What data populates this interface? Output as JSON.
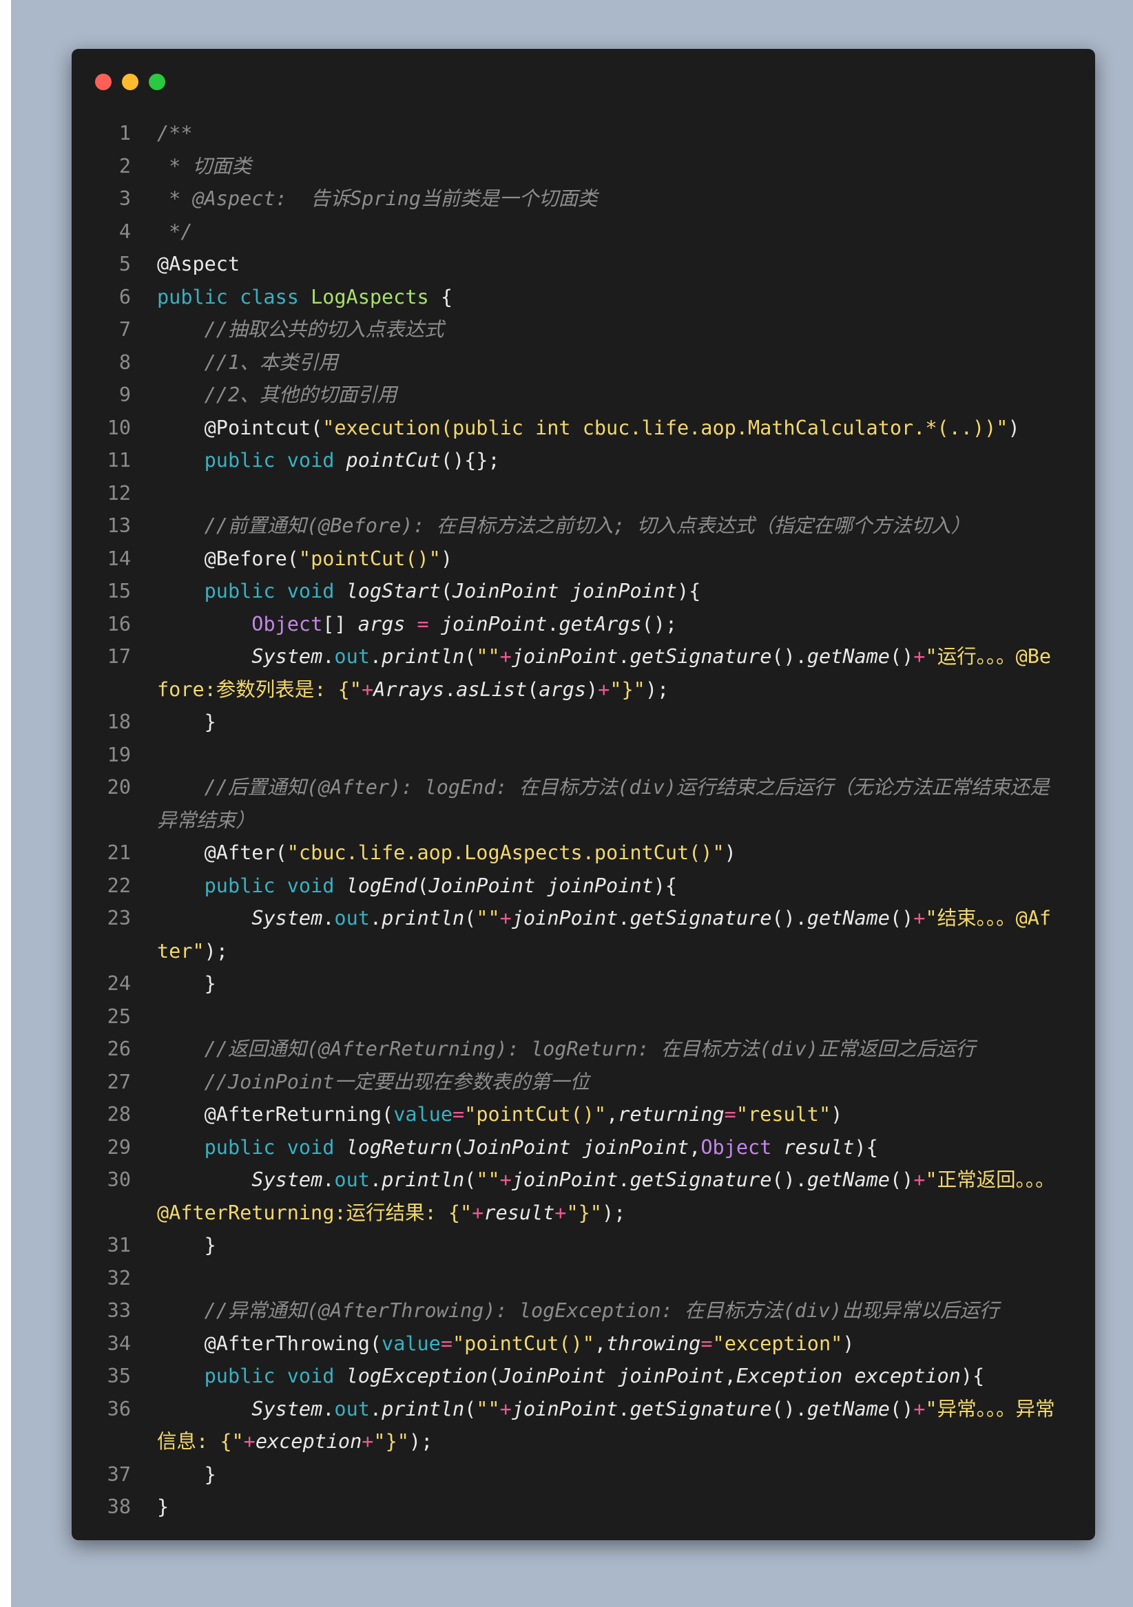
{
  "window": {
    "buttons": [
      {
        "name": "close",
        "color": "#fe5f57"
      },
      {
        "name": "minimize",
        "color": "#febb2e"
      },
      {
        "name": "zoom",
        "color": "#2bc840"
      }
    ]
  },
  "colors": {
    "d": "#e8e8e8",
    "c": "#8c8c8c",
    "k": "#36b2c4",
    "s": "#f3d86b",
    "t": "#a7e265",
    "p": "#c487e6",
    "o": "#f0578f",
    "f": "#e8e8e8",
    "n": "#8b8b8b"
  },
  "code": {
    "lines": [
      {
        "n": "1",
        "s": [
          [
            "c",
            "/**"
          ]
        ]
      },
      {
        "n": "2",
        "s": [
          [
            "c",
            " * 切面类"
          ]
        ]
      },
      {
        "n": "3",
        "s": [
          [
            "c",
            " * @Aspect:  告诉Spring当前类是一个切面类"
          ]
        ]
      },
      {
        "n": "4",
        "s": [
          [
            "c",
            " */"
          ]
        ]
      },
      {
        "n": "5",
        "s": [
          [
            "d",
            "@Aspect"
          ]
        ]
      },
      {
        "n": "6",
        "s": [
          [
            "k",
            "public class "
          ],
          [
            "t",
            "LogAspects"
          ],
          [
            "d",
            " {"
          ]
        ]
      },
      {
        "n": "7",
        "s": [
          [
            "c",
            "    //抽取公共的切入点表达式"
          ]
        ]
      },
      {
        "n": "8",
        "s": [
          [
            "c",
            "    //1、本类引用"
          ]
        ]
      },
      {
        "n": "9",
        "s": [
          [
            "c",
            "    //2、其他的切面引用"
          ]
        ]
      },
      {
        "n": "10",
        "s": [
          [
            "d",
            "    @Pointcut("
          ],
          [
            "s",
            "\"execution(public int cbuc.life.aop.MathCalculator.*(..))\""
          ],
          [
            "d",
            ")"
          ]
        ]
      },
      {
        "n": "11",
        "s": [
          [
            "k",
            "    public void "
          ],
          [
            "f",
            "pointCut"
          ],
          [
            "d",
            "(){};"
          ]
        ]
      },
      {
        "n": "12",
        "s": []
      },
      {
        "n": "13",
        "s": [
          [
            "c",
            "    //前置通知(@Before): 在目标方法之前切入; 切入点表达式（指定在哪个方法切入）"
          ]
        ]
      },
      {
        "n": "14",
        "s": [
          [
            "d",
            "    @Before("
          ],
          [
            "s",
            "\"pointCut()\""
          ],
          [
            "d",
            ")"
          ]
        ]
      },
      {
        "n": "15",
        "s": [
          [
            "k",
            "    public void "
          ],
          [
            "f",
            "logStart"
          ],
          [
            "d",
            "("
          ],
          [
            "f",
            "JoinPoint joinPoint"
          ],
          [
            "d",
            "){"
          ]
        ]
      },
      {
        "n": "16",
        "s": [
          [
            "p",
            "        Object"
          ],
          [
            "d",
            "[] "
          ],
          [
            "f",
            "args"
          ],
          [
            "o",
            " = "
          ],
          [
            "f",
            "joinPoint"
          ],
          [
            "d",
            "."
          ],
          [
            "f",
            "getArgs"
          ],
          [
            "d",
            "();"
          ]
        ]
      },
      {
        "n": "17",
        "w": true,
        "s": [
          [
            "f",
            "        System"
          ],
          [
            "d",
            "."
          ],
          [
            "k",
            "out"
          ],
          [
            "d",
            "."
          ],
          [
            "f",
            "println"
          ],
          [
            "d",
            "("
          ],
          [
            "s",
            "\"\""
          ],
          [
            "o",
            "+"
          ],
          [
            "f",
            "joinPoint"
          ],
          [
            "d",
            "."
          ],
          [
            "f",
            "getSignature"
          ],
          [
            "d",
            "()."
          ],
          [
            "f",
            "getName"
          ],
          [
            "d",
            "()"
          ],
          [
            "o",
            "+"
          ],
          [
            "s",
            "\"运行。。。@Before:参数列表是: {\""
          ],
          [
            "o",
            "+"
          ],
          [
            "f",
            "Arrays"
          ],
          [
            "d",
            "."
          ],
          [
            "f",
            "asList"
          ],
          [
            "d",
            "("
          ],
          [
            "f",
            "args"
          ],
          [
            "d",
            ")"
          ],
          [
            "o",
            "+"
          ],
          [
            "s",
            "\"}\""
          ],
          [
            "d",
            ");"
          ]
        ]
      },
      {
        "n": "18",
        "s": [
          [
            "d",
            "    }"
          ]
        ]
      },
      {
        "n": "19",
        "s": []
      },
      {
        "n": "20",
        "w": true,
        "s": [
          [
            "c",
            "    //后置通知(@After): logEnd: 在目标方法(div)运行结束之后运行（无论方法正常结束还是异常结束）"
          ]
        ]
      },
      {
        "n": "21",
        "s": [
          [
            "d",
            "    @After("
          ],
          [
            "s",
            "\"cbuc.life.aop.LogAspects.pointCut()\""
          ],
          [
            "d",
            ")"
          ]
        ]
      },
      {
        "n": "22",
        "s": [
          [
            "k",
            "    public void "
          ],
          [
            "f",
            "logEnd"
          ],
          [
            "d",
            "("
          ],
          [
            "f",
            "JoinPoint joinPoint"
          ],
          [
            "d",
            "){"
          ]
        ]
      },
      {
        "n": "23",
        "w": true,
        "s": [
          [
            "f",
            "        System"
          ],
          [
            "d",
            "."
          ],
          [
            "k",
            "out"
          ],
          [
            "d",
            "."
          ],
          [
            "f",
            "println"
          ],
          [
            "d",
            "("
          ],
          [
            "s",
            "\"\""
          ],
          [
            "o",
            "+"
          ],
          [
            "f",
            "joinPoint"
          ],
          [
            "d",
            "."
          ],
          [
            "f",
            "getSignature"
          ],
          [
            "d",
            "()."
          ],
          [
            "f",
            "getName"
          ],
          [
            "d",
            "()"
          ],
          [
            "o",
            "+"
          ],
          [
            "s",
            "\"结束。。。@After\""
          ],
          [
            "d",
            ");"
          ]
        ]
      },
      {
        "n": "24",
        "s": [
          [
            "d",
            "    }"
          ]
        ]
      },
      {
        "n": "25",
        "s": []
      },
      {
        "n": "26",
        "s": [
          [
            "c",
            "    //返回通知(@AfterReturning): logReturn: 在目标方法(div)正常返回之后运行"
          ]
        ]
      },
      {
        "n": "27",
        "s": [
          [
            "c",
            "    //JoinPoint一定要出现在参数表的第一位"
          ]
        ]
      },
      {
        "n": "28",
        "s": [
          [
            "d",
            "    @AfterReturning("
          ],
          [
            "k",
            "value"
          ],
          [
            "o",
            "="
          ],
          [
            "s",
            "\"pointCut()\""
          ],
          [
            "d",
            ","
          ],
          [
            "f",
            "returning"
          ],
          [
            "o",
            "="
          ],
          [
            "s",
            "\"result\""
          ],
          [
            "d",
            ")"
          ]
        ]
      },
      {
        "n": "29",
        "s": [
          [
            "k",
            "    public void "
          ],
          [
            "f",
            "logReturn"
          ],
          [
            "d",
            "("
          ],
          [
            "f",
            "JoinPoint joinPoint"
          ],
          [
            "d",
            ","
          ],
          [
            "p",
            "Object"
          ],
          [
            "f",
            " result"
          ],
          [
            "d",
            "){"
          ]
        ]
      },
      {
        "n": "30",
        "w": true,
        "s": [
          [
            "f",
            "        System"
          ],
          [
            "d",
            "."
          ],
          [
            "k",
            "out"
          ],
          [
            "d",
            "."
          ],
          [
            "f",
            "println"
          ],
          [
            "d",
            "("
          ],
          [
            "s",
            "\"\""
          ],
          [
            "o",
            "+"
          ],
          [
            "f",
            "joinPoint"
          ],
          [
            "d",
            "."
          ],
          [
            "f",
            "getSignature"
          ],
          [
            "d",
            "()."
          ],
          [
            "f",
            "getName"
          ],
          [
            "d",
            "()"
          ],
          [
            "o",
            "+"
          ],
          [
            "s",
            "\"正常返回。。。@AfterReturning:运行结果: {\""
          ],
          [
            "o",
            "+"
          ],
          [
            "f",
            "result"
          ],
          [
            "o",
            "+"
          ],
          [
            "s",
            "\"}\""
          ],
          [
            "d",
            ");"
          ]
        ]
      },
      {
        "n": "31",
        "s": [
          [
            "d",
            "    }"
          ]
        ]
      },
      {
        "n": "32",
        "s": []
      },
      {
        "n": "33",
        "s": [
          [
            "c",
            "    //异常通知(@AfterThrowing): logException: 在目标方法(div)出现异常以后运行"
          ]
        ]
      },
      {
        "n": "34",
        "s": [
          [
            "d",
            "    @AfterThrowing("
          ],
          [
            "k",
            "value"
          ],
          [
            "o",
            "="
          ],
          [
            "s",
            "\"pointCut()\""
          ],
          [
            "d",
            ","
          ],
          [
            "f",
            "throwing"
          ],
          [
            "o",
            "="
          ],
          [
            "s",
            "\"exception\""
          ],
          [
            "d",
            ")"
          ]
        ]
      },
      {
        "n": "35",
        "s": [
          [
            "k",
            "    public void "
          ],
          [
            "f",
            "logException"
          ],
          [
            "d",
            "("
          ],
          [
            "f",
            "JoinPoint joinPoint"
          ],
          [
            "d",
            ","
          ],
          [
            "f",
            "Exception exception"
          ],
          [
            "d",
            "){"
          ]
        ]
      },
      {
        "n": "36",
        "w": true,
        "s": [
          [
            "f",
            "        System"
          ],
          [
            "d",
            "."
          ],
          [
            "k",
            "out"
          ],
          [
            "d",
            "."
          ],
          [
            "f",
            "println"
          ],
          [
            "d",
            "("
          ],
          [
            "s",
            "\"\""
          ],
          [
            "o",
            "+"
          ],
          [
            "f",
            "joinPoint"
          ],
          [
            "d",
            "."
          ],
          [
            "f",
            "getSignature"
          ],
          [
            "d",
            "()."
          ],
          [
            "f",
            "getName"
          ],
          [
            "d",
            "()"
          ],
          [
            "o",
            "+"
          ],
          [
            "s",
            "\"异常。。。异常信息: {\""
          ],
          [
            "o",
            "+"
          ],
          [
            "f",
            "exception"
          ],
          [
            "o",
            "+"
          ],
          [
            "s",
            "\"}\""
          ],
          [
            "d",
            ");"
          ]
        ]
      },
      {
        "n": "37",
        "s": [
          [
            "d",
            "    }"
          ]
        ]
      },
      {
        "n": "38",
        "s": [
          [
            "d",
            "}"
          ]
        ]
      }
    ]
  }
}
